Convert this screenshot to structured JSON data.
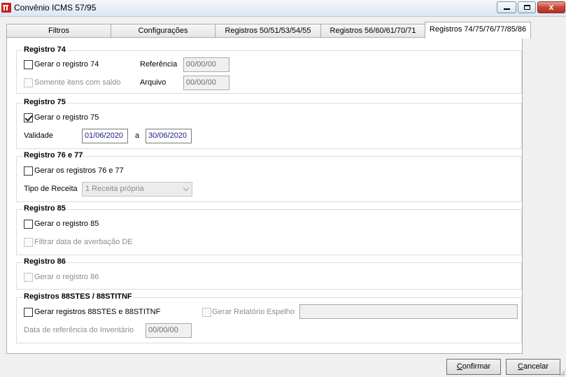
{
  "window": {
    "title": "Convênio ICMS 57/95",
    "close_glyph": "x"
  },
  "tabs": [
    {
      "label": "Filtros"
    },
    {
      "label": "Configurações"
    },
    {
      "label": "Registros 50/51/53/54/55"
    },
    {
      "label": "Registros 56/60/61/70/71"
    },
    {
      "label": "Registros 74/75/76/77/85/86"
    }
  ],
  "r74": {
    "title": "Registro 74",
    "gerar_label": "Gerar o registro 74",
    "gerar_checked": false,
    "somente_label": "Somente itens com saldo",
    "somente_checked": false,
    "referencia_label": "Referência",
    "referencia_value": "00/00/00",
    "arquivo_label": "Arquivo",
    "arquivo_value": "00/00/00"
  },
  "r75": {
    "title": "Registro 75",
    "gerar_label": "Gerar o registro 75",
    "gerar_checked": true,
    "validade_label": "Validade",
    "date_from": "01/06/2020",
    "sep": "a",
    "date_to": "30/06/2020"
  },
  "r76": {
    "title": "Registro 76 e 77",
    "gerar_label": "Gerar os registros 76 e 77",
    "gerar_checked": false,
    "tipo_label": "Tipo de Receita",
    "tipo_value": "1 Receita própria"
  },
  "r85": {
    "title": "Registro 85",
    "gerar_label": "Gerar o registro 85",
    "gerar_checked": false,
    "filtrar_label": "Filtrar data de averbação DE",
    "filtrar_checked": false
  },
  "r86": {
    "title": "Registro 86",
    "gerar_label": "Gerar o registro 86",
    "gerar_checked": false
  },
  "r88": {
    "title": "Registros 88STES / 88STITNF",
    "gerar_label": "Gerar registros 88STES e 88STITNF",
    "gerar_checked": false,
    "espelho_label": "Gerar Relatório Espelho",
    "espelho_checked": false,
    "espelho_value": "",
    "data_label": "Data de referência do Inventário",
    "data_value": "00/00/00"
  },
  "buttons": {
    "confirm_first": "C",
    "confirm_rest": "onfirmar",
    "cancel_first": "C",
    "cancel_rest": "ancelar"
  }
}
